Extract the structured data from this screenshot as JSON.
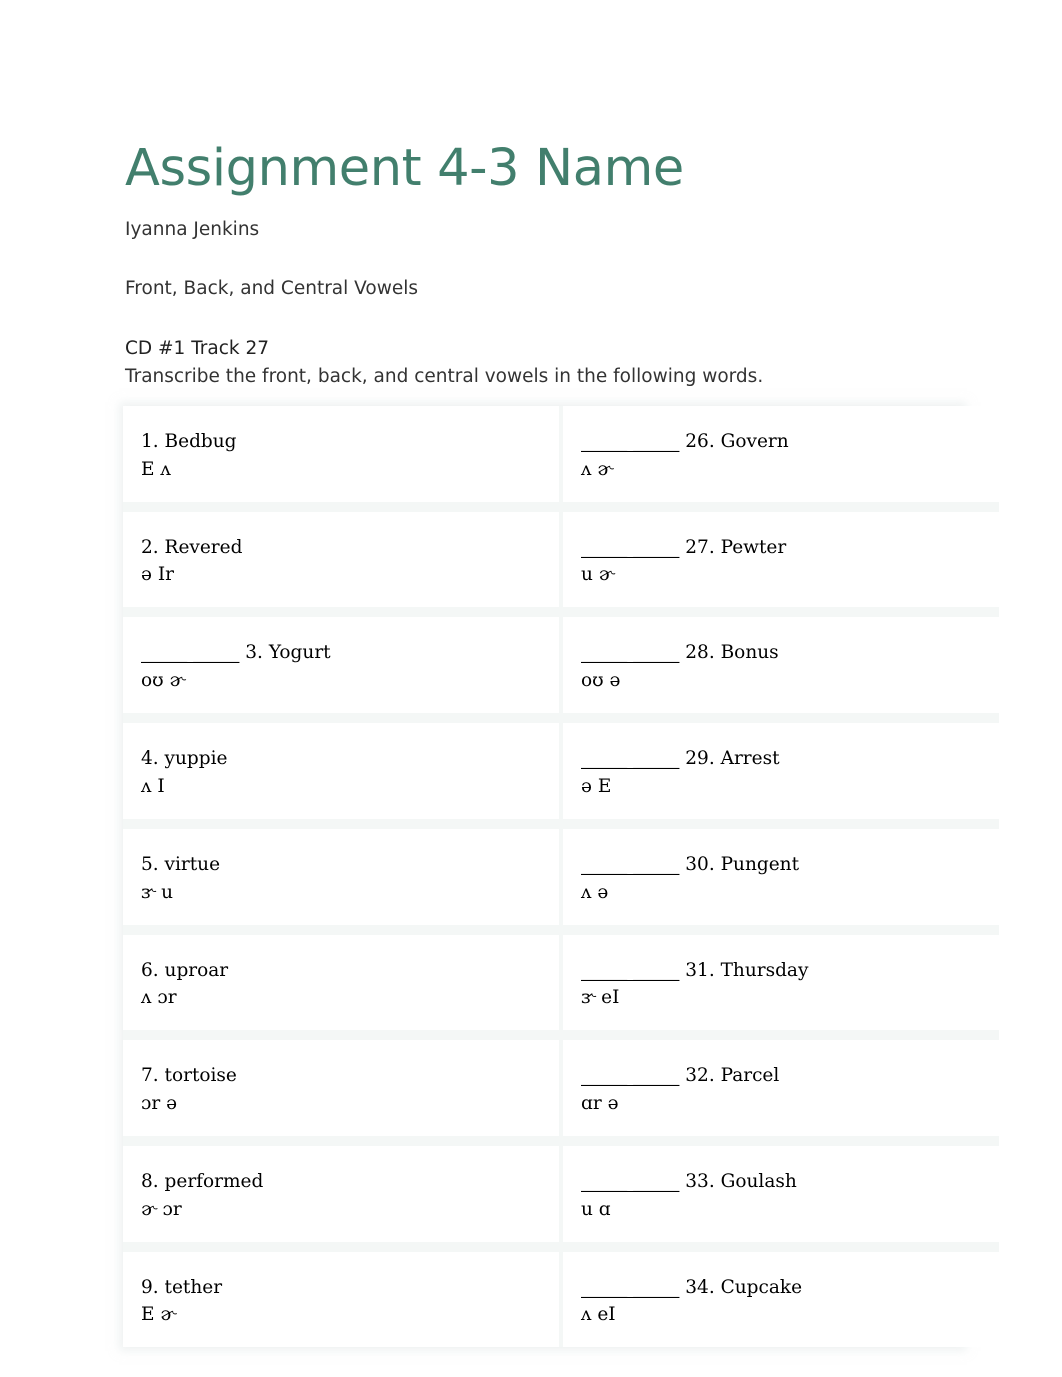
{
  "document": {
    "title": "Assignment 4-3 Name",
    "author": "Iyanna Jenkins",
    "subject": "Front, Back, and Central Vowels",
    "track": "CD #1 Track 27",
    "instruction": "Transcribe the front, back, and central vowels in the following words.",
    "title_color": "#427f6d",
    "body_color": "#333333"
  },
  "worksheet": {
    "blank_mark": "_____ _____",
    "rows": [
      {
        "left": {
          "blanks": "",
          "prompt": "1. Bedbug",
          "answer": "E ʌ"
        },
        "right": {
          "blanks": "_____ _____",
          "prompt": "26. Govern",
          "answer": "ʌ ɚ"
        }
      },
      {
        "left": {
          "blanks": "",
          "prompt": "2. Revered",
          "answer": "ə Ir"
        },
        "right": {
          "blanks": "_____ _____",
          "prompt": "27. Pewter",
          "answer": "u ɚ"
        }
      },
      {
        "left": {
          "blanks": "_____ _____",
          "prompt": "3. Yogurt",
          "answer": "oʊ ɚ"
        },
        "right": {
          "blanks": "_____ _____",
          "prompt": "28. Bonus",
          "answer": "oʊ ə"
        }
      },
      {
        "left": {
          "blanks": "",
          "prompt": "4. yuppie",
          "answer": "ʌ I"
        },
        "right": {
          "blanks": "_____ _____",
          "prompt": "29. Arrest",
          "answer": "ə E"
        }
      },
      {
        "left": {
          "blanks": "",
          "prompt": "5. virtue",
          "answer": "ɝ u"
        },
        "right": {
          "blanks": "_____ _____",
          "prompt": "30. Pungent",
          "answer": "ʌ ə"
        }
      },
      {
        "left": {
          "blanks": "",
          "prompt": "6. uproar",
          "answer": "ʌ ɔr"
        },
        "right": {
          "blanks": "_____ _____",
          "prompt": "31. Thursday",
          "answer": "ɝ eI"
        }
      },
      {
        "left": {
          "blanks": "",
          "prompt": "7. tortoise",
          "answer": "ɔr ə"
        },
        "right": {
          "blanks": "_____ _____",
          "prompt": "32. Parcel",
          "answer": "ɑr ə"
        }
      },
      {
        "left": {
          "blanks": "",
          "prompt": "8. performed",
          "answer": "ɚ ɔr"
        },
        "right": {
          "blanks": "_____ _____",
          "prompt": "33. Goulash",
          "answer": "u ɑ"
        }
      },
      {
        "left": {
          "blanks": "",
          "prompt": "9. tether",
          "answer": "E ɚ"
        },
        "right": {
          "blanks": "_____ _____",
          "prompt": "34. Cupcake",
          "answer": "ʌ eI"
        }
      }
    ]
  }
}
